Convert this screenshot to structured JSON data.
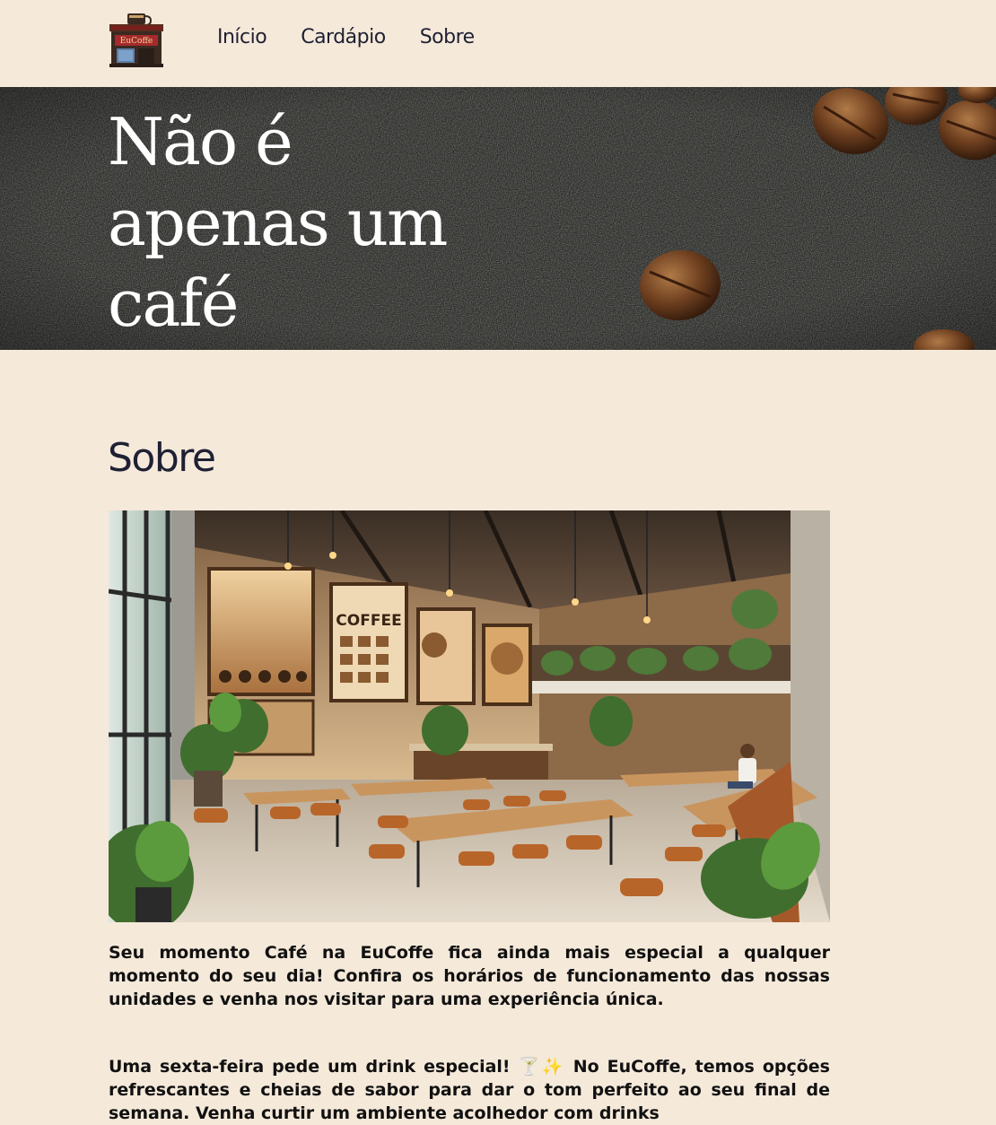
{
  "header": {
    "logo": {
      "sign_text": "EuCoffe",
      "icon": "coffee-shop-logo-icon"
    },
    "nav": [
      {
        "label": "Início"
      },
      {
        "label": "Cardápio"
      },
      {
        "label": "Sobre"
      }
    ]
  },
  "hero": {
    "title_line1": "Não é",
    "title_line2": "apenas um",
    "title_line3": "café",
    "background_icon": "coffee-beans-image"
  },
  "about": {
    "title": "Sobre",
    "image_icon": "cafe-interior-image",
    "image_poster_text": "COFFEE",
    "paragraph1": "Seu momento Café na EuCoffe fica ainda mais especial a qualquer momento do seu dia! Confira os horários de funcionamento das nossas unidades e venha nos visitar para uma experiência única.",
    "paragraph2": "Uma sexta-feira pede um drink especial! 🍸✨ No EuCoffe, temos opções refrescantes e cheias de sabor para dar o tom perfeito ao seu final de semana. Venha curtir um ambiente acolhedor com drinks"
  },
  "colors": {
    "page_background": "#f5e9da",
    "nav_text": "#1f2033",
    "hero_background": "#2a2a28",
    "hero_text": "#ffffff",
    "body_text": "#111111"
  }
}
